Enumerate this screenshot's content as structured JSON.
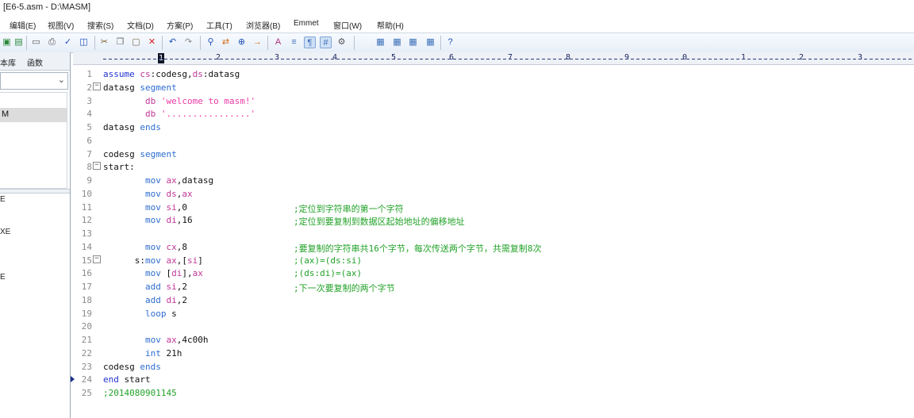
{
  "title": "[E6-5.asm - D:\\MASM]",
  "menu": [
    "编辑(E)",
    "视图(V)",
    "搜索(S)",
    "文档(D)",
    "方案(P)",
    "工具(T)",
    "浏览器(B)",
    "Emmet",
    "窗口(W)",
    "帮助(H)"
  ],
  "toolbar_icons": [
    "save-icon",
    "save-all-icon",
    "print-preview-icon",
    "print-icon",
    "spell-check-icon",
    "compare-icon",
    "cut-icon",
    "copy-icon",
    "paste-icon",
    "delete-icon",
    "undo-icon",
    "redo-icon",
    "find-icon",
    "replace-icon",
    "find-in-files-icon",
    "goto-icon",
    "font-icon",
    "word-wrap-icon",
    "show-whitespace-icon",
    "line-numbers-icon",
    "settings-icon",
    "window-1-icon",
    "window-2-icon",
    "window-3-icon",
    "window-4-icon",
    "help-icon"
  ],
  "sidebar": {
    "tabs": [
      "本库",
      "函数"
    ],
    "list1_selected": "M",
    "files": [
      "E",
      "XE",
      "E"
    ]
  },
  "ruler": [
    "1",
    "2",
    "3",
    "4",
    "5",
    "6",
    "7",
    "8",
    "9",
    "0",
    "1",
    "2",
    "3"
  ],
  "editor": {
    "lines": [
      {
        "n": "1",
        "parts": [
          {
            "t": "assume ",
            "c": "kw"
          },
          {
            "t": "cs",
            "c": "seg"
          },
          {
            "t": ":codesg,",
            "c": "plain"
          },
          {
            "t": "ds",
            "c": "seg"
          },
          {
            "t": ":datasg",
            "c": "plain"
          }
        ]
      },
      {
        "n": "2",
        "fold": true,
        "parts": [
          {
            "t": "datasg ",
            "c": "plain"
          },
          {
            "t": "segment",
            "c": "op"
          }
        ]
      },
      {
        "n": "3",
        "parts": [
          {
            "t": "        db ",
            "c": "seg"
          },
          {
            "t": "'welcome to masm!'",
            "c": "str"
          }
        ]
      },
      {
        "n": "4",
        "parts": [
          {
            "t": "        db ",
            "c": "seg"
          },
          {
            "t": "'................'",
            "c": "str"
          }
        ]
      },
      {
        "n": "5",
        "parts": [
          {
            "t": "datasg ",
            "c": "plain"
          },
          {
            "t": "ends",
            "c": "op"
          }
        ]
      },
      {
        "n": "6",
        "parts": []
      },
      {
        "n": "7",
        "parts": [
          {
            "t": "codesg ",
            "c": "plain"
          },
          {
            "t": "segment",
            "c": "op"
          }
        ]
      },
      {
        "n": "8",
        "fold": true,
        "parts": [
          {
            "t": "start:",
            "c": "plain"
          }
        ]
      },
      {
        "n": "9",
        "parts": [
          {
            "t": "        mov ",
            "c": "op"
          },
          {
            "t": "ax",
            "c": "seg"
          },
          {
            "t": ",datasg",
            "c": "plain"
          }
        ]
      },
      {
        "n": "10",
        "parts": [
          {
            "t": "        mov ",
            "c": "op"
          },
          {
            "t": "ds",
            "c": "seg"
          },
          {
            "t": ",",
            "c": "plain"
          },
          {
            "t": "ax",
            "c": "seg"
          }
        ]
      },
      {
        "n": "11",
        "parts": [
          {
            "t": "        mov ",
            "c": "op"
          },
          {
            "t": "si",
            "c": "seg"
          },
          {
            "t": ",0",
            "c": "plain"
          }
        ],
        "comment": ";定位到字符串的第一个字符"
      },
      {
        "n": "12",
        "parts": [
          {
            "t": "        mov ",
            "c": "op"
          },
          {
            "t": "di",
            "c": "seg"
          },
          {
            "t": ",16",
            "c": "plain"
          }
        ],
        "comment": ";定位到要复制到数据区起始地址的偏移地址"
      },
      {
        "n": "13",
        "parts": []
      },
      {
        "n": "14",
        "parts": [
          {
            "t": "        mov ",
            "c": "op"
          },
          {
            "t": "cx",
            "c": "seg"
          },
          {
            "t": ",8",
            "c": "plain"
          }
        ],
        "comment": ";要复制的字符串共16个字节，每次传送两个字节，共需复制8次"
      },
      {
        "n": "15",
        "fold": true,
        "parts": [
          {
            "t": "      s:",
            "c": "plain"
          },
          {
            "t": "mov ",
            "c": "op"
          },
          {
            "t": "ax",
            "c": "seg"
          },
          {
            "t": ",[",
            "c": "plain"
          },
          {
            "t": "si",
            "c": "seg"
          },
          {
            "t": "]",
            "c": "plain"
          }
        ],
        "comment": ";(ax)=(ds:si)"
      },
      {
        "n": "16",
        "parts": [
          {
            "t": "        mov ",
            "c": "op"
          },
          {
            "t": "[",
            "c": "plain"
          },
          {
            "t": "di",
            "c": "seg"
          },
          {
            "t": "],",
            "c": "plain"
          },
          {
            "t": "ax",
            "c": "seg"
          }
        ],
        "comment": ";(ds:di)=(ax)"
      },
      {
        "n": "17",
        "parts": [
          {
            "t": "        add ",
            "c": "op"
          },
          {
            "t": "si",
            "c": "seg"
          },
          {
            "t": ",2",
            "c": "plain"
          }
        ],
        "comment": ";下一次要复制的两个字节"
      },
      {
        "n": "18",
        "parts": [
          {
            "t": "        add ",
            "c": "op"
          },
          {
            "t": "di",
            "c": "seg"
          },
          {
            "t": ",2",
            "c": "plain"
          }
        ]
      },
      {
        "n": "19",
        "parts": [
          {
            "t": "        loop ",
            "c": "op"
          },
          {
            "t": "s",
            "c": "plain"
          }
        ]
      },
      {
        "n": "20",
        "parts": []
      },
      {
        "n": "21",
        "parts": [
          {
            "t": "        mov ",
            "c": "op"
          },
          {
            "t": "ax",
            "c": "seg"
          },
          {
            "t": ",4c00h",
            "c": "plain"
          }
        ]
      },
      {
        "n": "22",
        "parts": [
          {
            "t": "        int ",
            "c": "op"
          },
          {
            "t": "21h",
            "c": "plain"
          }
        ]
      },
      {
        "n": "23",
        "parts": [
          {
            "t": "codesg ",
            "c": "plain"
          },
          {
            "t": "ends",
            "c": "op"
          }
        ]
      },
      {
        "n": "24",
        "marker": true,
        "parts": [
          {
            "t": "end ",
            "c": "kw"
          },
          {
            "t": "start",
            "c": "plain"
          }
        ]
      },
      {
        "n": "25",
        "parts": [
          {
            "t": ";2014080901145",
            "c": "green"
          }
        ]
      }
    ]
  }
}
